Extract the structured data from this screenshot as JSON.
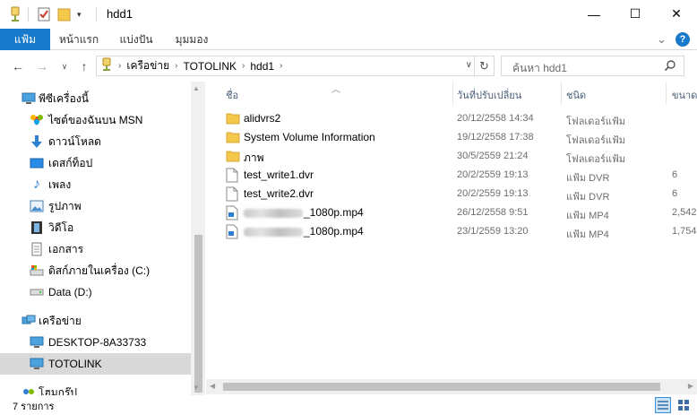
{
  "window": {
    "title": "hdd1",
    "minimize_glyph": "—",
    "maximize_glyph": "☐",
    "close_glyph": "✕"
  },
  "ribbon": {
    "tabs": [
      "แฟ้ม",
      "หน้าแรก",
      "แบ่งปัน",
      "มุมมอง"
    ],
    "expand_glyph": "⌄",
    "help_glyph": "?"
  },
  "address": {
    "crumbs": [
      "เครือข่าย",
      "TOTOLINK",
      "hdd1"
    ],
    "search_placeholder": "ค้นหา hdd1"
  },
  "nav": {
    "items": [
      {
        "label": "พีซีเครื่องนี้",
        "icon": "computer-icon"
      },
      {
        "label": "ไซต์ของฉันบน MSN",
        "icon": "msn-icon"
      },
      {
        "label": "ดาวน์โหลด",
        "icon": "download-icon"
      },
      {
        "label": "เดสก์ท็อป",
        "icon": "desktop-icon"
      },
      {
        "label": "เพลง",
        "icon": "music-icon"
      },
      {
        "label": "รูปภาพ",
        "icon": "pictures-icon"
      },
      {
        "label": "วิดีโอ",
        "icon": "video-icon"
      },
      {
        "label": "เอกสาร",
        "icon": "documents-icon"
      },
      {
        "label": "ดิสก์ภายในเครื่อง (C:)",
        "icon": "local-disk-icon"
      },
      {
        "label": "Data (D:)",
        "icon": "drive-icon"
      },
      {
        "label": "เครือข่าย",
        "icon": "network-icon"
      },
      {
        "label": "DESKTOP-8A33733",
        "icon": "network-computer-icon"
      },
      {
        "label": "TOTOLINK",
        "icon": "network-computer-icon"
      },
      {
        "label": "โฮมกรุ๊ป",
        "icon": "homegroup-icon"
      }
    ]
  },
  "columns": {
    "name": "ชื่อ",
    "date": "วันที่ปรับเปลี่ยน",
    "type": "ชนิด",
    "size": "ขนาด"
  },
  "files": [
    {
      "name": "alidvrs2",
      "date": "20/12/2558 14:34",
      "type": "โฟลเดอร์แฟ้ม",
      "size": "",
      "kind": "folder"
    },
    {
      "name": "System Volume Information",
      "date": "19/12/2558 17:38",
      "type": "โฟลเดอร์แฟ้ม",
      "size": "",
      "kind": "folder"
    },
    {
      "name": "ภาพ",
      "date": "30/5/2559 21:24",
      "type": "โฟลเดอร์แฟ้ม",
      "size": "",
      "kind": "folder"
    },
    {
      "name": "test_write1.dvr",
      "date": "20/2/2559 19:13",
      "type": "แฟ้ม DVR",
      "size": "6",
      "kind": "file"
    },
    {
      "name": "test_write2.dvr",
      "date": "20/2/2559 19:13",
      "type": "แฟ้ม DVR",
      "size": "6",
      "kind": "file"
    },
    {
      "name": "_1080p.mp4",
      "date": "26/12/2558 9:51",
      "type": "แฟ้ม MP4",
      "size": "2,542",
      "kind": "video"
    },
    {
      "name": "_1080p.mp4",
      "date": "23/1/2559 13:20",
      "type": "แฟ้ม MP4",
      "size": "1,754",
      "kind": "video"
    }
  ],
  "status": {
    "item_count": "7 รายการ"
  },
  "colors": {
    "file_tab": "#1979ca",
    "selected_nav": "#d9d9d9",
    "folder": "#f5c84b"
  }
}
